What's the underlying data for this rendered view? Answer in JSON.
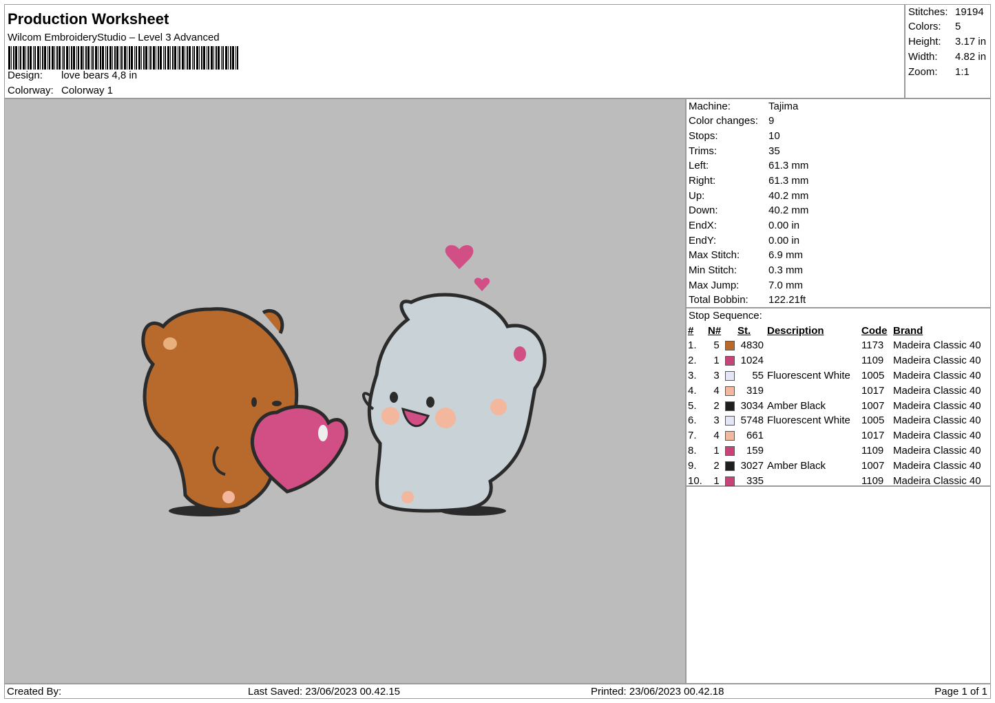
{
  "header": {
    "title": "Production Worksheet",
    "subtitle": "Wilcom EmbroideryStudio – Level 3 Advanced",
    "design_label": "Design:",
    "design_value": "love bears  4,8 in",
    "colorway_label": "Colorway:",
    "colorway_value": "Colorway 1"
  },
  "stats": [
    {
      "label": "Stitches:",
      "value": "19194"
    },
    {
      "label": "Colors:",
      "value": "5"
    },
    {
      "label": "Height:",
      "value": "3.17 in"
    },
    {
      "label": "Width:",
      "value": "4.82 in"
    },
    {
      "label": "Zoom:",
      "value": "1:1"
    }
  ],
  "machine_info": [
    {
      "label": "Machine:",
      "value": "Tajima"
    },
    {
      "label": "Color changes:",
      "value": "9"
    },
    {
      "label": "Stops:",
      "value": "10"
    },
    {
      "label": "Trims:",
      "value": "35"
    },
    {
      "label": "Left:",
      "value": "61.3 mm"
    },
    {
      "label": "Right:",
      "value": "61.3 mm"
    },
    {
      "label": "Up:",
      "value": "40.2 mm"
    },
    {
      "label": "Down:",
      "value": "40.2 mm"
    },
    {
      "label": "EndX:",
      "value": "0.00 in"
    },
    {
      "label": "EndY:",
      "value": "0.00 in"
    },
    {
      "label": "Max Stitch:",
      "value": "6.9 mm"
    },
    {
      "label": "Min Stitch:",
      "value": "0.3 mm"
    },
    {
      "label": "Max Jump:",
      "value": "7.0 mm"
    },
    {
      "label": "Total Bobbin:",
      "value": "122.21ft"
    }
  ],
  "stop_sequence": {
    "label": "Stop Sequence:",
    "headers": {
      "idx": "#",
      "n": "N#",
      "st": "St.",
      "desc": "Description",
      "code": "Code",
      "brand": "Brand"
    },
    "rows": [
      {
        "idx": "1.",
        "n": "5",
        "color": "#b86a2c",
        "st": "4830",
        "desc": "",
        "code": "1173",
        "brand": "Madeira Classic 40"
      },
      {
        "idx": "2.",
        "n": "1",
        "color": "#c8437a",
        "st": "1024",
        "desc": "",
        "code": "1109",
        "brand": "Madeira Classic 40"
      },
      {
        "idx": "3.",
        "n": "3",
        "color": "#e4e6f8",
        "st": "55",
        "desc": "Fluorescent White",
        "code": "1005",
        "brand": "Madeira Classic 40"
      },
      {
        "idx": "4.",
        "n": "4",
        "color": "#f2b79c",
        "st": "319",
        "desc": "",
        "code": "1017",
        "brand": "Madeira Classic 40"
      },
      {
        "idx": "5.",
        "n": "2",
        "color": "#1e1e1e",
        "st": "3034",
        "desc": "Amber Black",
        "code": "1007",
        "brand": "Madeira Classic 40"
      },
      {
        "idx": "6.",
        "n": "3",
        "color": "#e4e6f8",
        "st": "5748",
        "desc": "Fluorescent White",
        "code": "1005",
        "brand": "Madeira Classic 40"
      },
      {
        "idx": "7.",
        "n": "4",
        "color": "#f2b79c",
        "st": "661",
        "desc": "",
        "code": "1017",
        "brand": "Madeira Classic 40"
      },
      {
        "idx": "8.",
        "n": "1",
        "color": "#c8437a",
        "st": "159",
        "desc": "",
        "code": "1109",
        "brand": "Madeira Classic 40"
      },
      {
        "idx": "9.",
        "n": "2",
        "color": "#1e1e1e",
        "st": "3027",
        "desc": "Amber Black",
        "code": "1007",
        "brand": "Madeira Classic 40"
      },
      {
        "idx": "10.",
        "n": "1",
        "color": "#c8437a",
        "st": "335",
        "desc": "",
        "code": "1109",
        "brand": "Madeira Classic 40"
      }
    ]
  },
  "footer": {
    "created_by": "Created By:",
    "last_saved": "Last Saved: 23/06/2023 00.42.15",
    "printed": "Printed: 23/06/2023 00.42.18",
    "page": "Page 1 of 1"
  },
  "preview": {
    "background": "#bcbcbc",
    "brown_bear": "#b86a2c",
    "grey_bear": "#c9d2d6",
    "outline": "#2b2b2b",
    "heart": "#d24f85",
    "blush": "#f2b79c"
  }
}
